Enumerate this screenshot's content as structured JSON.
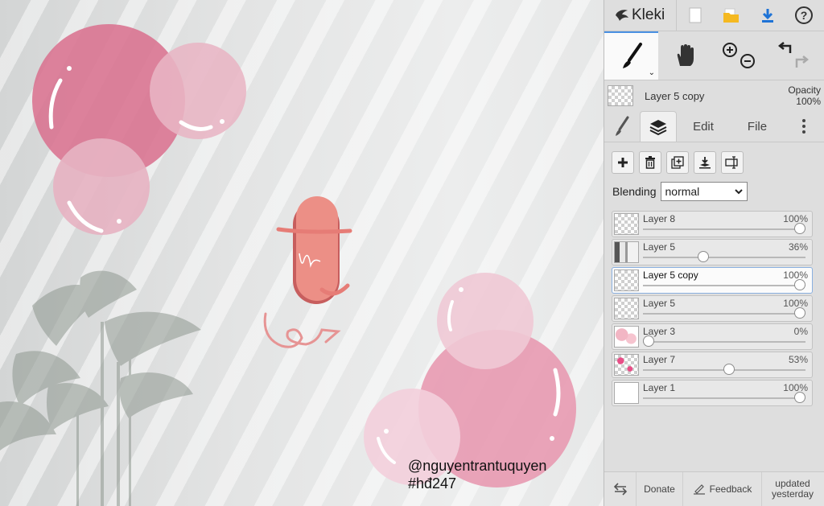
{
  "app": {
    "name": "Kleki"
  },
  "topbar": {
    "icons": [
      "logo-bird-icon",
      "new-image-icon",
      "open-folder-icon",
      "download-icon",
      "help-icon"
    ]
  },
  "tools": {
    "brush": "brush-icon",
    "hand": "hand-icon",
    "zoom_in": "zoom-in-icon",
    "zoom_out": "zoom-out-icon",
    "undo": "undo-icon",
    "redo": "redo-icon"
  },
  "current_layer": {
    "name": "Layer 5 copy",
    "opacity_label": "Opacity",
    "opacity_value": "100%"
  },
  "tabs": {
    "edit": "Edit",
    "file": "File"
  },
  "blending": {
    "label": "Blending",
    "value": "normal"
  },
  "layers": [
    {
      "name": "Layer 8",
      "opacity": "100%",
      "value": 1.0,
      "thumb": "checker"
    },
    {
      "name": "Layer 5",
      "opacity": "36%",
      "value": 0.36,
      "thumb": "photo"
    },
    {
      "name": "Layer 5 copy",
      "opacity": "100%",
      "value": 1.0,
      "thumb": "checker",
      "active": true
    },
    {
      "name": "Layer 5",
      "opacity": "100%",
      "value": 1.0,
      "thumb": "checker"
    },
    {
      "name": "Layer 3",
      "opacity": "0%",
      "value": 0.0,
      "thumb": "pink"
    },
    {
      "name": "Layer 7",
      "opacity": "53%",
      "value": 0.53,
      "thumb": "pinkdots"
    },
    {
      "name": "Layer 1",
      "opacity": "100%",
      "value": 1.0,
      "thumb": "white"
    }
  ],
  "footer": {
    "donate": "Donate",
    "feedback": "Feedback",
    "updated_line1": "updated",
    "updated_line2": "yesterday"
  },
  "canvas": {
    "credit": "@nguyentrantuquyen",
    "tag": "#hđ247"
  },
  "colors": {
    "accent": "#4a90e2",
    "bubble_pink": "#e48fa9",
    "panel_bg": "#dedede"
  }
}
